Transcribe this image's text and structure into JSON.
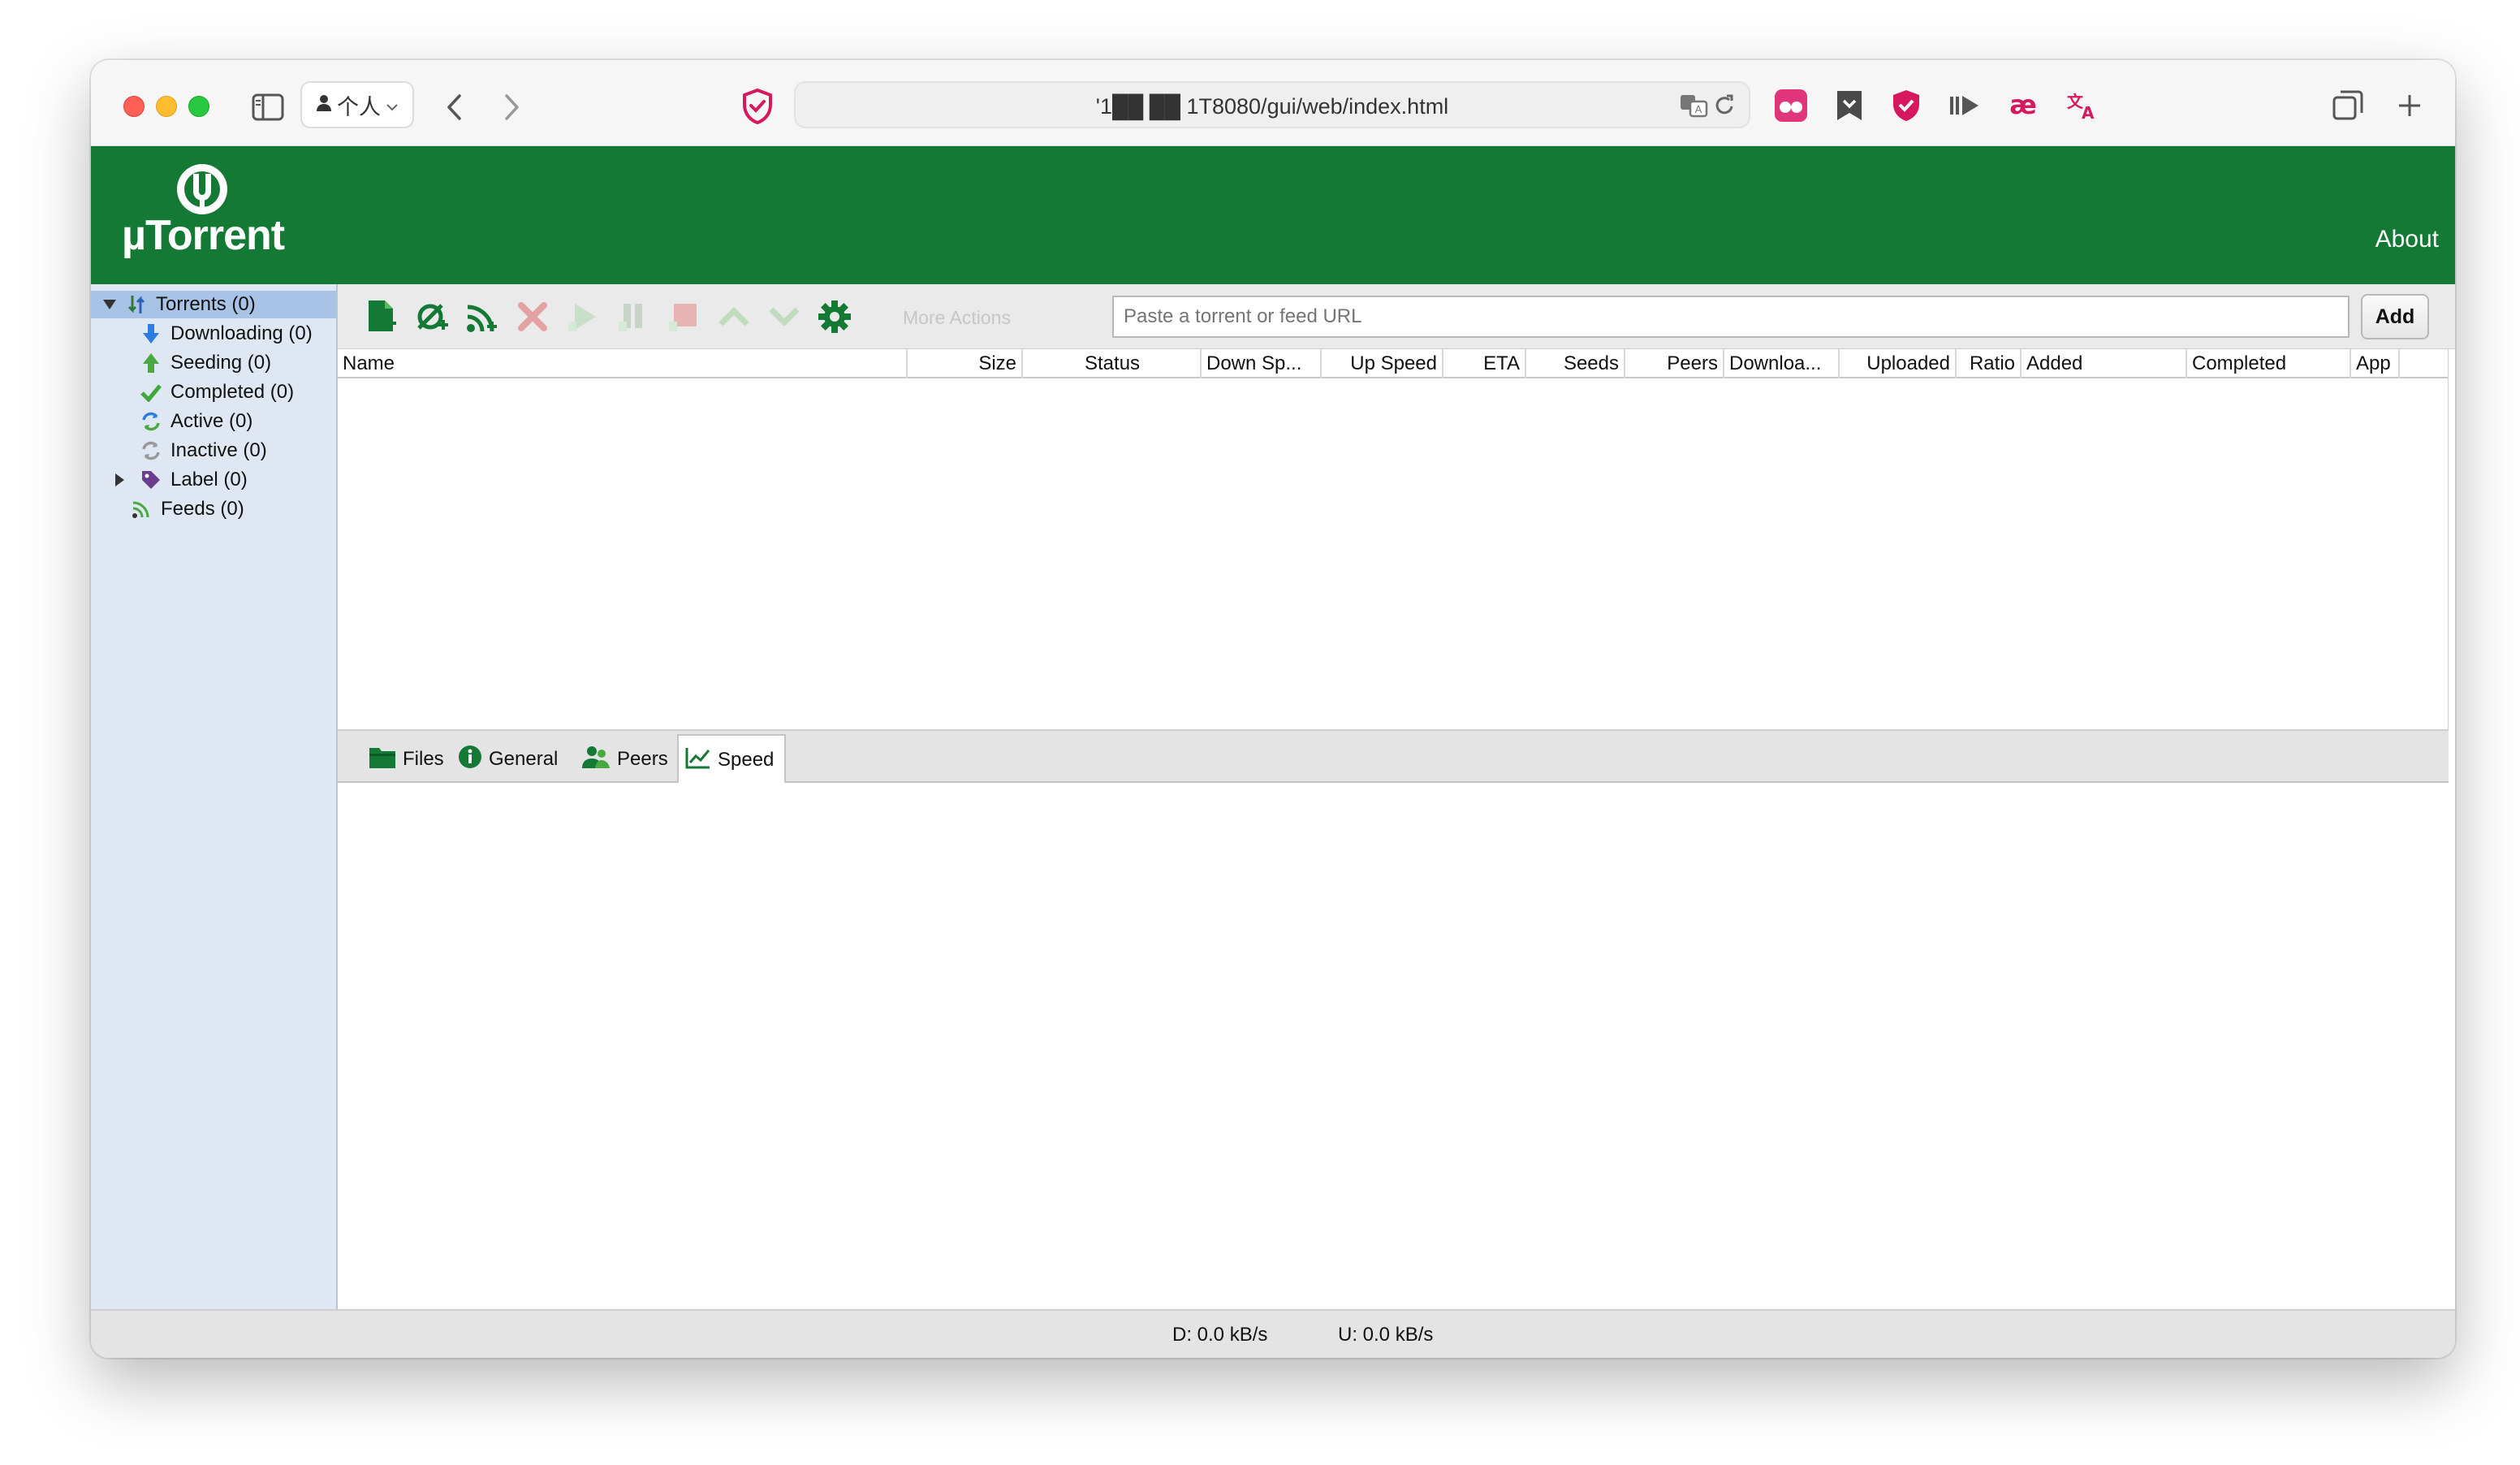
{
  "browser": {
    "profile_label": "个人",
    "url": "'1██ ██ 1T8080/gui/web/index.html"
  },
  "app": {
    "logo_text": "µTorrent",
    "about_label": "About"
  },
  "tree": {
    "items": [
      {
        "label": "Torrents (0)"
      },
      {
        "label": "Downloading (0)"
      },
      {
        "label": "Seeding (0)"
      },
      {
        "label": "Completed (0)"
      },
      {
        "label": "Active (0)"
      },
      {
        "label": "Inactive (0)"
      },
      {
        "label": "Label (0)"
      },
      {
        "label": "Feeds (0)"
      }
    ]
  },
  "toolbar": {
    "more_actions_label": "More Actions",
    "url_placeholder": "Paste a torrent or feed URL",
    "add_label": "Add"
  },
  "table": {
    "columns": [
      "Name",
      "Size",
      "Status",
      "Down Sp...",
      "Up Speed",
      "ETA",
      "Seeds",
      "Peers",
      "Downloa...",
      "Uploaded",
      "Ratio",
      "Added",
      "Completed",
      "App"
    ]
  },
  "tabs": [
    {
      "label": "Files"
    },
    {
      "label": "General"
    },
    {
      "label": "Peers"
    },
    {
      "label": "Speed"
    }
  ],
  "status": {
    "down": "D: 0.0 kB/s",
    "up": "U: 0.0 kB/s"
  },
  "colors": {
    "brand_green": "#137934",
    "tree_bg": "#dfe7f2",
    "tree_selected": "#a9c3e6"
  }
}
